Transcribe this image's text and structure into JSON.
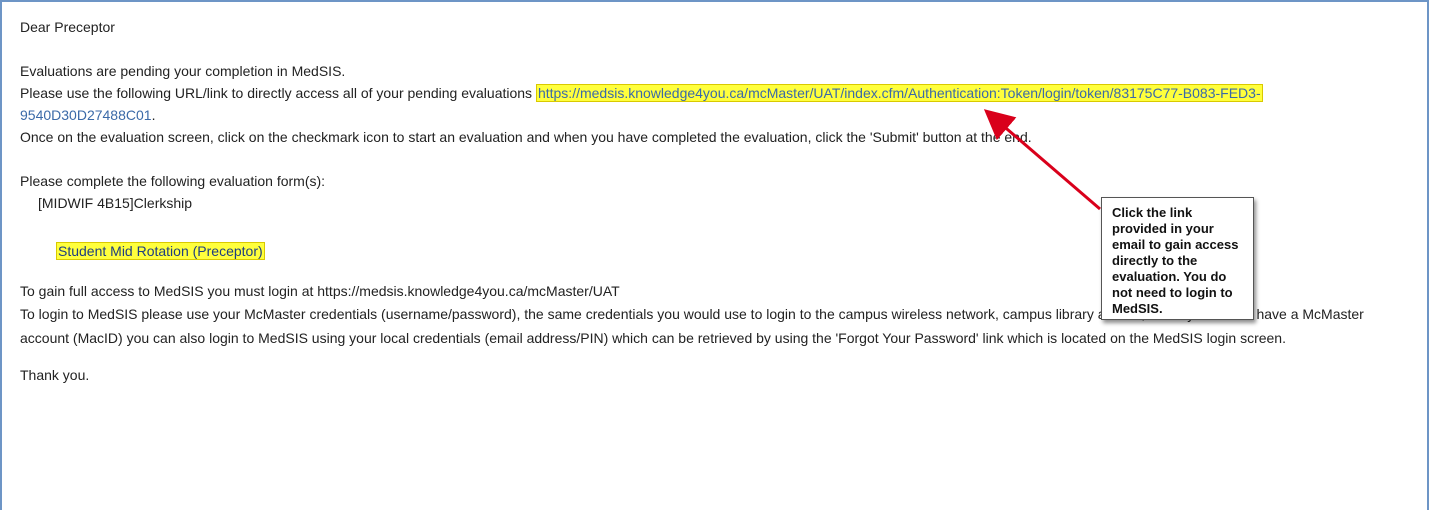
{
  "email": {
    "greeting": "Dear   Preceptor",
    "pending_notice": "Evaluations are pending your completion in MedSIS.",
    "url_intro": "Please use the following URL/link to directly access all of your pending evaluations ",
    "url_part1": "https://medsis.knowledge4you.ca/mcMaster/UAT/index.cfm/Authentication:Token/login/token/83175C77-B083-FED3-",
    "url_part2": "9540D30D27488C01",
    "url_end": ".",
    "instructions": "Once on the evaluation screen, click on the checkmark icon to start an evaluation and when you have completed the evaluation, click the 'Submit' button at the end.",
    "forms_intro": "Please complete the following evaluation form(s):",
    "course": "[MIDWIF 4B15]Clerkship",
    "form_link": "Student Mid Rotation (Preceptor)",
    "full_access": "To gain full access to MedSIS you must login at https://medsis.knowledge4you.ca/mcMaster/UAT",
    "login_info": "To login to MedSIS please use your McMaster credentials (username/password), the same credentials you would use to login to the campus wireless network, campus library access, etc. If you do not have a McMaster account (MacID) you can also login to MedSIS using your local credentials (email address/PIN) which can be retrieved by using the 'Forgot Your Password' link which is located on the MedSIS login screen.",
    "thanks": "Thank you."
  },
  "callout": {
    "text": "Click the link provided in your email to gain access directly to the evaluation.  You do not need to login to MedSIS."
  },
  "colors": {
    "highlight": "#ffff3c",
    "link": "#3b6aa8",
    "frame": "#6d95c6",
    "arrow": "#d9001b"
  }
}
